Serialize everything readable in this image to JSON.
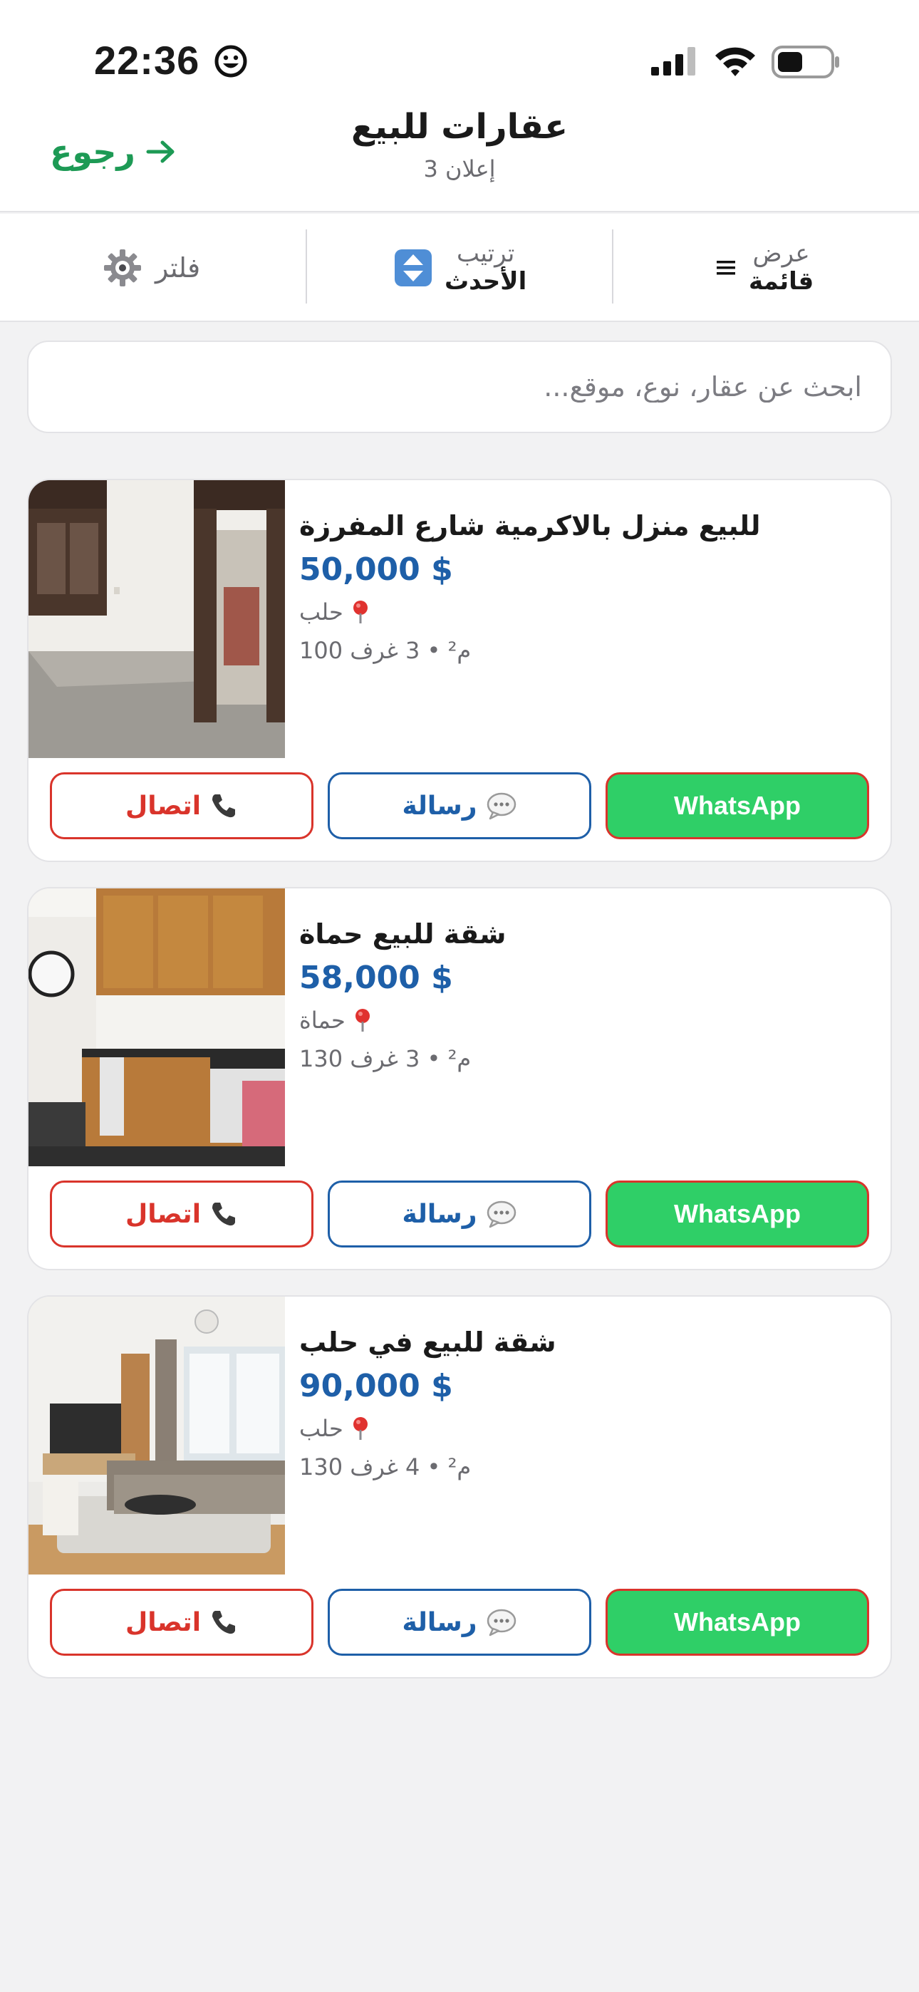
{
  "status_bar": {
    "time": "22:36"
  },
  "header": {
    "back_label": "رجوع",
    "title": "عقارات للبيع",
    "subtitle": "3 إعلان"
  },
  "toolbar": {
    "view_label": "عرض",
    "view_value": "قائمة",
    "sort_label": "ترتيب",
    "sort_value": "الأحدث",
    "filter_label": "فلتر"
  },
  "search": {
    "placeholder": "ابحث عن عقار، نوع، موقع..."
  },
  "listings": [
    {
      "title": "للبيع منزل بالاكرمية شارع المفرزة",
      "price": "50,000 $",
      "location": "حلب",
      "meta": "100 م² • 3 غرف",
      "image": "empty-room-photo"
    },
    {
      "title": "شقة للبيع حماة",
      "price": "58,000 $",
      "location": "حماة",
      "meta": "130 م² • 3 غرف",
      "image": "kitchen-photo"
    },
    {
      "title": "شقة للبيع في حلب",
      "price": "90,000 $",
      "location": "حلب",
      "meta": "130 م² • 4 غرف",
      "image": "living-room-photo"
    }
  ],
  "actions": {
    "whatsapp": "WhatsApp",
    "message": "رسالة",
    "call": "اتصال"
  },
  "colors": {
    "accent_green": "#1d9a55",
    "price_blue": "#1e5fa8",
    "call_red": "#d9342b",
    "whatsapp_green": "#2fcf67"
  }
}
